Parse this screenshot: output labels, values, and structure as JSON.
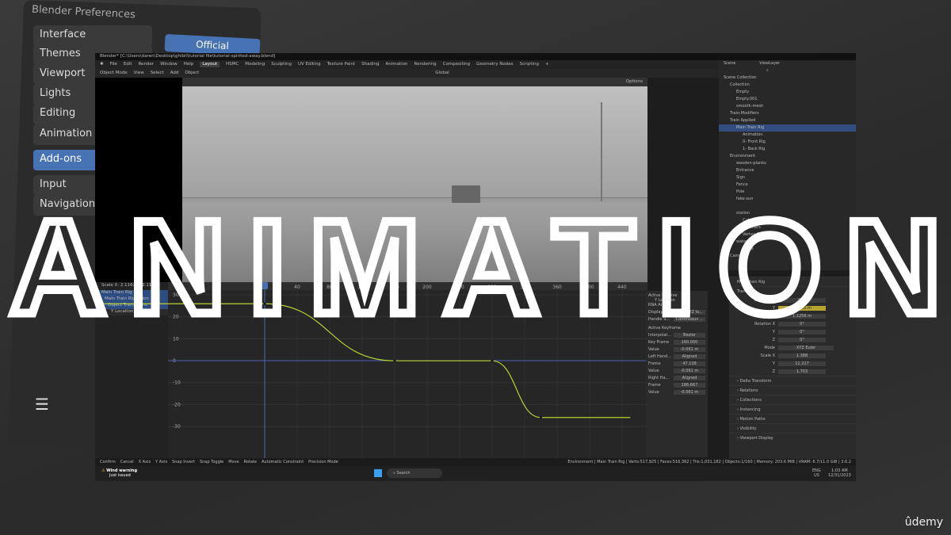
{
  "overlay_title": "ANIMATION",
  "watermark": "ûdemy",
  "preferences": {
    "title": "Blender Preferences",
    "items": [
      "Interface",
      "Themes",
      "Viewport",
      "Lights",
      "Editing",
      "Animation",
      "Add-ons",
      "Input",
      "Navigation"
    ],
    "selected": "Add-ons",
    "official_tab": "Official"
  },
  "window": {
    "title": "Blender* [C:\\Users\\daren\\Desktop\\ghibli\\tutorial file\\tutorial-spirited-away.blend]",
    "menus": [
      "File",
      "Edit",
      "Render",
      "Window",
      "Help"
    ],
    "workspaces": [
      "Layout",
      "HSMC",
      "Modeling",
      "Sculpting",
      "UV Editing",
      "Texture Paint",
      "Shading",
      "Animation",
      "Rendering",
      "Compositing",
      "Geometry Nodes",
      "Scripting",
      "+"
    ],
    "active_workspace": "Layout",
    "header": [
      "Object Mode",
      "View",
      "Select",
      "Add",
      "Object"
    ],
    "transform_orientation": "Global",
    "options": "Options",
    "scene": "Scene",
    "view_layer": "ViewLayer"
  },
  "graph": {
    "cursor_readout": "Scale X: 2.1162  Y: 2.1162",
    "channels": [
      "Main Train Rig",
      "Main Train RigAction",
      "Object Transforms",
      "Y Location"
    ],
    "accent": "#b5d22f"
  },
  "chart_data": {
    "type": "line",
    "x_ticks": [
      40,
      80,
      120,
      160,
      200,
      240,
      280,
      320,
      360,
      400,
      440
    ],
    "y_ticks": [
      30,
      20,
      10,
      0,
      -10,
      -20,
      -30
    ],
    "xlim": [
      -200,
      450
    ],
    "ylim": [
      -35,
      33
    ],
    "current_frame": 0,
    "series": [
      {
        "name": "Y Location",
        "x": [
          -200,
          0,
          160,
          280,
          340,
          450
        ],
        "y": [
          25.9,
          25.9,
          -0.061,
          -0.061,
          -25.9,
          -25.9
        ]
      }
    ]
  },
  "fcurve_panel": {
    "active_fcurve": "Active F-Curve",
    "channel": "Y Location",
    "rna": "RNA Array",
    "display_color_label": "Display C...",
    "display_color": "Auto XYZ to...",
    "handle_label": "Handle S...",
    "handle": "Continuous ...",
    "active_keyframe": "Active Keyframe",
    "rows": [
      [
        "Interpolat...",
        "Bezier"
      ],
      [
        "Key Frame",
        "160.000"
      ],
      [
        "Value",
        "-0.061 m"
      ],
      [
        "Left Hand...",
        "Aligned"
      ],
      [
        "Frame",
        "47.138"
      ],
      [
        "Value",
        "-0.061 m"
      ],
      [
        "Right Ha...",
        "Aligned"
      ],
      [
        "Frame",
        "186.667"
      ],
      [
        "Value",
        "-0.061 m"
      ]
    ],
    "tabs": [
      "F-Curve",
      "Modifiers",
      "View"
    ]
  },
  "outliner": {
    "items": [
      {
        "label": "Scene Collection",
        "d": 0
      },
      {
        "label": "Collection",
        "d": 1
      },
      {
        "label": "Empty",
        "d": 2
      },
      {
        "label": "Empty.001",
        "d": 2
      },
      {
        "label": "smooth-mesh",
        "d": 2
      },
      {
        "label": "Train-Modifiers",
        "d": 1
      },
      {
        "label": "Train Applied",
        "d": 1
      },
      {
        "label": "Main Train Rig",
        "d": 2,
        "sel": true
      },
      {
        "label": "Animation",
        "d": 3
      },
      {
        "label": "0- Front Rig",
        "d": 3
      },
      {
        "label": "1- Back Rig",
        "d": 3
      },
      {
        "label": "Environment",
        "d": 1
      },
      {
        "label": "wooden-planks",
        "d": 2
      },
      {
        "label": "Entrance",
        "d": 2
      },
      {
        "label": "Sign",
        "d": 2
      },
      {
        "label": "Fence",
        "d": 2
      },
      {
        "label": "Pole",
        "d": 2
      },
      {
        "label": "fake-sun",
        "d": 2
      },
      {
        "label": "",
        "d": 2
      },
      {
        "label": "station",
        "d": 2
      },
      {
        "label": "Cube.013",
        "d": 3
      },
      {
        "label": "Modifiers",
        "d": 3
      },
      {
        "label": "Vertex Groups",
        "d": 3
      },
      {
        "label": "water",
        "d": 2
      },
      {
        "label": "Plane",
        "d": 3
      },
      {
        "label": "Camera",
        "d": 1
      }
    ]
  },
  "properties": {
    "object": "Main Train Rig",
    "transform": "Transform",
    "location": {
      "label": "Location X",
      "x": "0 m",
      "y": "25.926 m",
      "z": "1.1256 m"
    },
    "rotation": {
      "label": "Rotation X",
      "x": "0°",
      "y": "0°",
      "z": "0°"
    },
    "mode_label": "Mode",
    "mode": "XYZ Euler",
    "scale": {
      "label": "Scale X",
      "x": "1.388",
      "y": "11.227",
      "z": "1.703"
    },
    "sections": [
      "Delta Transform",
      "Relations",
      "Collections",
      "Instancing",
      "Motion Paths",
      "Visibility",
      "Viewport Display"
    ]
  },
  "status": {
    "hints": [
      "Confirm",
      "Cancel",
      "X Axis",
      "Y Axis",
      "Snap Invert",
      "Snap Toggle",
      "Move",
      "Rotate",
      "Automatic Constraint",
      "Precision Mode"
    ],
    "stats": "Environment | Main Train Rig | Verts:517,925 | Faces:516,362 | Tris:1,031,182 | Objects:1/160 | Memory: 203.6 MiB | VRAM: 6.7/11.0 GiB | 3.6.2"
  },
  "taskbar": {
    "notification_title": "Wind warning",
    "notification_sub": "Just issued",
    "search": "Search",
    "lang": "ENG",
    "region": "US",
    "time": "1:03 AM",
    "date": "12/31/2023"
  }
}
